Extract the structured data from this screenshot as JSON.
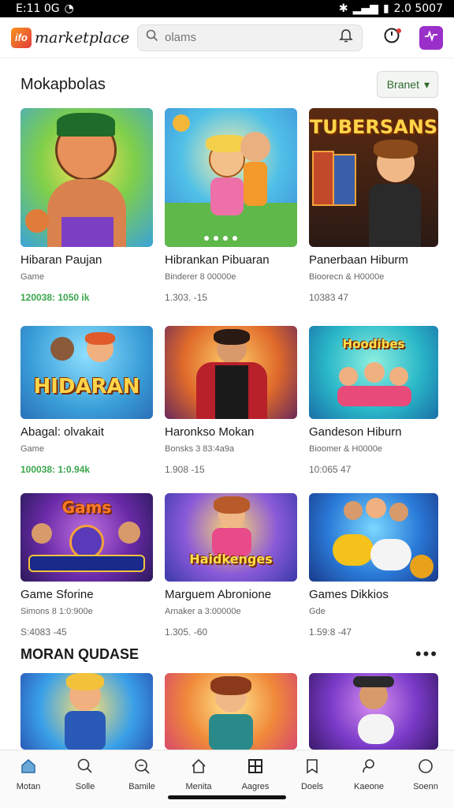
{
  "status": {
    "time": "E:11 0G",
    "right": "2.0 5007"
  },
  "header": {
    "logo_mark": "ifo",
    "logo_text": "marketplace",
    "search_placeholder": "olams"
  },
  "section1": {
    "title": "Mokapbolas",
    "filter_label": "Branet"
  },
  "section2": {
    "title": "MORAN QUDASE"
  },
  "cards": [
    {
      "title": "Hibaran Paujan",
      "sub": "Game",
      "meta": "120038: 1050 ik",
      "meta_green": true,
      "thumb_text": ""
    },
    {
      "title": "Hibrankan Pibuaran",
      "sub": "Binderer 8 00000e",
      "meta": "1.303. -15",
      "meta_green": false,
      "thumb_text": ""
    },
    {
      "title": "Panerbaan Hiburm",
      "sub": "Bioorecn & H0000e",
      "meta": "10383 47",
      "meta_green": false,
      "thumb_text": "TUBERSANS"
    },
    {
      "title": "Abagal: olvakait",
      "sub": "Game",
      "meta": "100038: 1:0.94k",
      "meta_green": true,
      "thumb_text": "HIDARAN"
    },
    {
      "title": "Haronkso Mokan",
      "sub": "Bonsks 3 83:4a9a",
      "meta": "1.908 -15",
      "meta_green": false,
      "thumb_text": ""
    },
    {
      "title": "Gandeson Hiburn",
      "sub": "Bioomer & H0000e",
      "meta": "10:065 47",
      "meta_green": false,
      "thumb_text": "Hoodibes"
    },
    {
      "title": "Game Sforine",
      "sub": "Simons 8 1:0:900e",
      "meta": "S:4083 -45",
      "meta_green": false,
      "thumb_text": "Gams"
    },
    {
      "title": "Marguem Abronione",
      "sub": "Arnaker a 3:00000e",
      "meta": "1.305. -60",
      "meta_green": false,
      "thumb_text": "Haidkenges"
    },
    {
      "title": "Games Dikkios",
      "sub": "Gde",
      "meta": "1.59:8 -47",
      "meta_green": false,
      "thumb_text": ""
    }
  ],
  "nav": [
    {
      "label": "Motan",
      "icon": "home-icon"
    },
    {
      "label": "Solle",
      "icon": "search-icon"
    },
    {
      "label": "Bamile",
      "icon": "zoom-icon"
    },
    {
      "label": "Menita",
      "icon": "house-outline-icon"
    },
    {
      "label": "Aagres",
      "icon": "grid-icon"
    },
    {
      "label": "Doels",
      "icon": "bookmark-icon"
    },
    {
      "label": "Kaeone",
      "icon": "chat-icon"
    },
    {
      "label": "Soenn",
      "icon": "circle-icon"
    }
  ],
  "colors": {
    "accent_green": "#3aa64c",
    "purple": "#9b2fc9",
    "logo_orange": "#f7931e"
  }
}
